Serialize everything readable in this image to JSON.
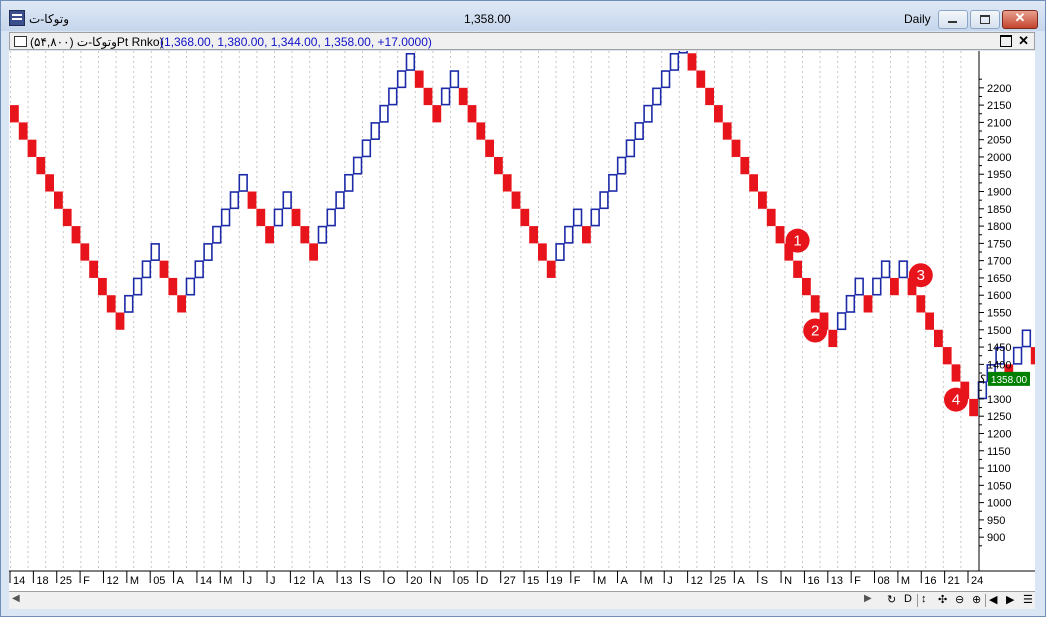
{
  "window": {
    "title": "وتوکا-ت",
    "last_price": "1,358.00",
    "period": "Daily"
  },
  "chart_header": {
    "symbol_label": "وتوکا-ت (۵۴,۸۰۰)Pt Rnko)",
    "ohlc": "(1,368.00, 1,380.00, 1,344.00, 1,358.00, +17.0000)"
  },
  "toolbar": {
    "tools": [
      "↻",
      "D",
      "↕",
      "✣",
      "⊖",
      "⊕",
      "◀",
      "▶",
      "☰"
    ]
  },
  "colors": {
    "up": "#1c2aa8",
    "down": "#e8141b",
    "marker": "#e8141b",
    "price_tag": "#008000"
  },
  "chart_data": {
    "type": "renko",
    "brick_size": 50,
    "start_top": 2150,
    "moves": [
      -13,
      4,
      -3,
      7,
      -3,
      2,
      -3,
      11,
      -3,
      2,
      -11,
      3,
      -1,
      11,
      -17,
      3,
      -1,
      2,
      -1,
      1,
      -8,
      3,
      -1,
      2,
      -1,
      2,
      -1,
      5,
      -3,
      3,
      -1,
      4,
      -1,
      13,
      -4
    ],
    "y_ticks": [
      900,
      950,
      1000,
      1050,
      1100,
      1150,
      1200,
      1250,
      1300,
      1350,
      1400,
      1450,
      1500,
      1550,
      1600,
      1650,
      1700,
      1750,
      1800,
      1850,
      1900,
      1950,
      2000,
      2050,
      2100,
      2150,
      2200
    ],
    "ylim": [
      860,
      2240
    ],
    "x_labels": [
      "14",
      "18",
      "25",
      "F",
      "12",
      "M",
      "05",
      "A",
      "14",
      "M",
      "J",
      "J",
      "12",
      "A",
      "13",
      "S",
      "O",
      "20",
      "N",
      "05",
      "D",
      "27",
      "15",
      "19",
      "F",
      "M",
      "A",
      "M",
      "J",
      "12",
      "25",
      "A",
      "S",
      "N",
      "16",
      "13",
      "F",
      "08",
      "M",
      "16",
      "21",
      "24"
    ],
    "last_price_tag": "1358.00",
    "annotations": [
      {
        "label": "1",
        "brick": 89,
        "pos": "above"
      },
      {
        "label": "2",
        "brick": 91,
        "pos": "below"
      },
      {
        "label": "3",
        "brick": 103,
        "pos": "above"
      },
      {
        "label": "4",
        "brick": 107,
        "pos": "below"
      },
      {
        "label": "؟",
        "brick": 107,
        "pos": "right"
      }
    ]
  }
}
